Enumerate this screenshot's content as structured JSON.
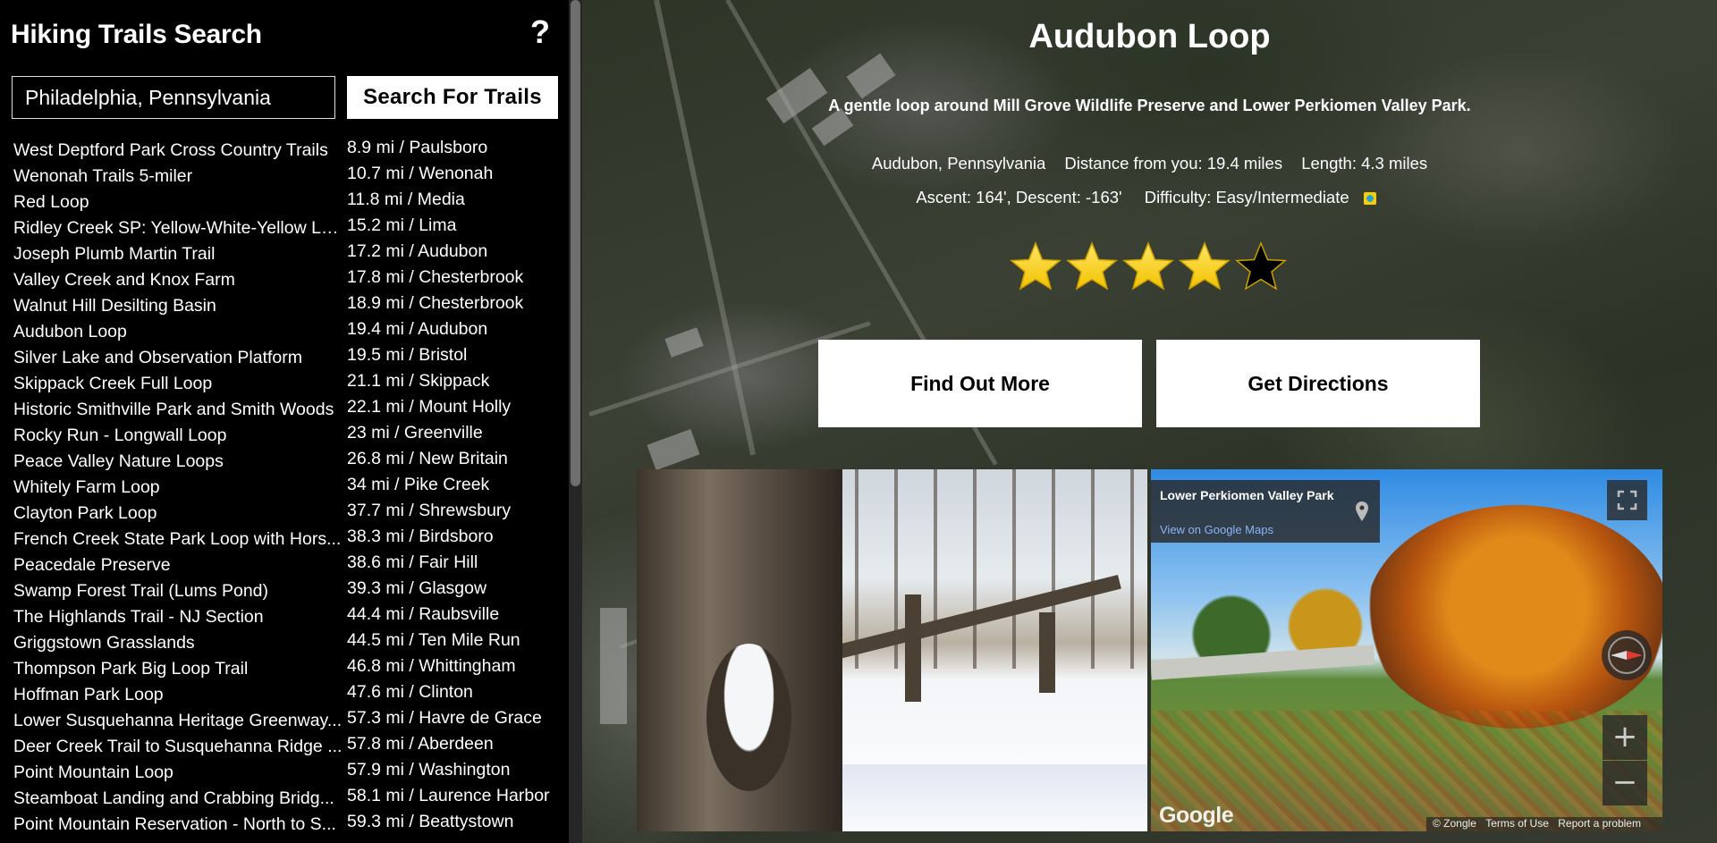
{
  "sidebar": {
    "title": "Hiking Trails Search",
    "help_label": "?",
    "search_value": "Philadelphia, Pennsylvania",
    "search_button": "Search For Trails",
    "trails": [
      {
        "name": "West Deptford Park Cross Country Trails",
        "dist": "8.9 mi / Paulsboro"
      },
      {
        "name": "Wenonah Trails 5-miler",
        "dist": "10.7 mi / Wenonah"
      },
      {
        "name": "Red Loop",
        "dist": "11.8 mi / Media"
      },
      {
        "name": "Ridley Creek SP: Yellow-White-Yellow Lo...",
        "dist": "15.2 mi / Lima"
      },
      {
        "name": "Joseph Plumb Martin Trail",
        "dist": "17.2 mi / Audubon"
      },
      {
        "name": "Valley Creek and Knox Farm",
        "dist": "17.8 mi / Chesterbrook"
      },
      {
        "name": "Walnut Hill Desilting Basin",
        "dist": "18.9 mi / Chesterbrook"
      },
      {
        "name": "Audubon Loop",
        "dist": "19.4 mi / Audubon"
      },
      {
        "name": "Silver Lake and Observation Platform",
        "dist": "19.5 mi / Bristol"
      },
      {
        "name": "Skippack Creek Full Loop",
        "dist": "21.1 mi / Skippack"
      },
      {
        "name": "Historic Smithville Park and Smith Woods",
        "dist": "22.1 mi / Mount Holly"
      },
      {
        "name": "Rocky Run - Longwall Loop",
        "dist": "23 mi / Greenville"
      },
      {
        "name": "Peace Valley Nature Loops",
        "dist": "26.8 mi / New Britain"
      },
      {
        "name": "Whitely Farm Loop",
        "dist": "34 mi / Pike Creek"
      },
      {
        "name": "Clayton Park Loop",
        "dist": "37.7 mi / Shrewsbury"
      },
      {
        "name": "French Creek State Park Loop with Hors...",
        "dist": "38.3 mi / Birdsboro"
      },
      {
        "name": "Peacedale Preserve",
        "dist": "38.6 mi / Fair Hill"
      },
      {
        "name": "Swamp Forest Trail (Lums Pond)",
        "dist": "39.3 mi / Glasgow"
      },
      {
        "name": "The Highlands Trail - NJ Section",
        "dist": "44.4 mi / Raubsville"
      },
      {
        "name": "Griggstown Grasslands",
        "dist": "44.5 mi / Ten Mile Run"
      },
      {
        "name": "Thompson Park Big Loop Trail",
        "dist": "46.8 mi / Whittingham"
      },
      {
        "name": "Hoffman Park Loop",
        "dist": "47.6 mi / Clinton"
      },
      {
        "name": "Lower Susquehanna Heritage Greenway...",
        "dist": "57.3 mi / Havre de Grace"
      },
      {
        "name": "Deer Creek Trail to Susquehanna Ridge ...",
        "dist": "57.8 mi / Aberdeen"
      },
      {
        "name": "Point Mountain Loop",
        "dist": "57.9 mi / Washington"
      },
      {
        "name": "Steamboat Landing and Crabbing Bridg...",
        "dist": "58.1 mi / Laurence Harbor"
      },
      {
        "name": "Point Mountain Reservation - North to S...",
        "dist": "59.3 mi / Beattystown"
      }
    ]
  },
  "details": {
    "title": "Audubon Loop",
    "description": "A gentle loop around Mill Grove Wildlife Preserve and Lower Perkiomen Valley Park.",
    "location": "Audubon, Pennsylvania",
    "distance": "Distance from you: 19.4 miles",
    "length": "Length: 4.3 miles",
    "elevation": "Ascent: 164', Descent: -163'",
    "difficulty": "Difficulty: Easy/Intermediate",
    "difficulty_icon": "blue-yellow-square-icon",
    "rating_stars": 4,
    "rating_max": 5,
    "star_colors": {
      "filled": "#f2c200",
      "empty": "#000000"
    },
    "find_button": "Find Out More",
    "directions_button": "Get Directions"
  },
  "streetview": {
    "place": "Lower Perkiomen Valley Park",
    "link": "View on Google Maps",
    "brand": "Google",
    "copyright": "© Zongle",
    "terms": "Terms of Use",
    "report": "Report a problem",
    "zoom_in": "+",
    "zoom_out": "−"
  }
}
